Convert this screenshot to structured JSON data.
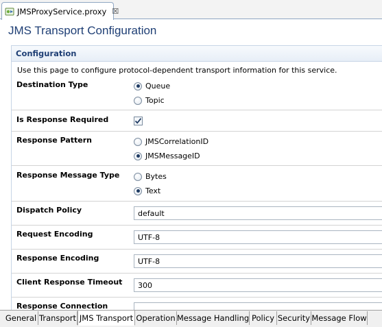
{
  "editor": {
    "tab_label": "JMSProxyService.proxy",
    "close_glyph": "☒"
  },
  "page": {
    "title": "JMS Transport Configuration"
  },
  "section": {
    "title": "Configuration",
    "description": "Use this page to configure protocol-dependent transport information for this service."
  },
  "fields": {
    "destination_type": {
      "label": "Destination Type",
      "options": [
        "Queue",
        "Topic"
      ],
      "selected": "Queue"
    },
    "is_response_required": {
      "label": "Is Response Required",
      "checked": true
    },
    "response_pattern": {
      "label": "Response Pattern",
      "options": [
        "JMSCorrelationID",
        "JMSMessageID"
      ],
      "selected": "JMSMessageID"
    },
    "response_message_type": {
      "label": "Response Message Type",
      "options": [
        "Bytes",
        "Text"
      ],
      "selected": "Text"
    },
    "dispatch_policy": {
      "label": "Dispatch Policy",
      "value": "default"
    },
    "request_encoding": {
      "label": "Request Encoding",
      "value": "UTF-8"
    },
    "response_encoding": {
      "label": "Response Encoding",
      "value": "UTF-8"
    },
    "client_response_timeout": {
      "label": "Client Response Timeout",
      "value": "300"
    },
    "response_connection": {
      "label": "Response Connection",
      "value": ""
    }
  },
  "page_tabs": [
    "General",
    "Transport",
    "JMS Transport",
    "Operation",
    "Message Handling",
    "Policy",
    "Security",
    "Message Flow"
  ],
  "active_page_tab": "JMS Transport",
  "colors": {
    "title": "#1f3f75",
    "section_header_bg": "#e7eef7",
    "border": "#c6d4e6"
  }
}
